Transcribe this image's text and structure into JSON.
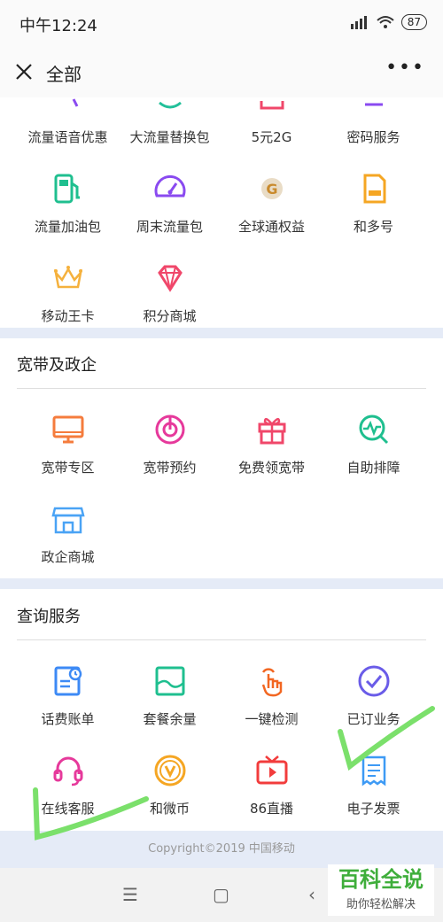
{
  "status": {
    "time": "中午12:24",
    "battery": "87"
  },
  "topbar": {
    "title": "全部"
  },
  "section1": {
    "items": [
      {
        "label": "流量语音优惠"
      },
      {
        "label": "大流量替换包"
      },
      {
        "label": "5元2G"
      },
      {
        "label": "密码服务"
      },
      {
        "label": "流量加油包"
      },
      {
        "label": "周末流量包"
      },
      {
        "label": "全球通权益"
      },
      {
        "label": "和多号"
      },
      {
        "label": "移动王卡"
      },
      {
        "label": "积分商城"
      }
    ]
  },
  "section2": {
    "title": "宽带及政企",
    "items": [
      {
        "label": "宽带专区"
      },
      {
        "label": "宽带预约"
      },
      {
        "label": "免费领宽带"
      },
      {
        "label": "自助排障"
      },
      {
        "label": "政企商城"
      }
    ]
  },
  "section3": {
    "title": "查询服务",
    "items": [
      {
        "label": "话费账单"
      },
      {
        "label": "套餐余量"
      },
      {
        "label": "一键检测"
      },
      {
        "label": "已订业务"
      },
      {
        "label": "在线客服"
      },
      {
        "label": "和微币"
      },
      {
        "label": "86直播"
      },
      {
        "label": "电子发票"
      }
    ]
  },
  "footer": {
    "copyright": "Copyright©2019 中国移动"
  },
  "watermark": {
    "line1": "百科全说",
    "line2": "助你轻松解决"
  },
  "colors": {
    "accent_bg": "#e5ebf7",
    "scribble": "#7be06b"
  }
}
